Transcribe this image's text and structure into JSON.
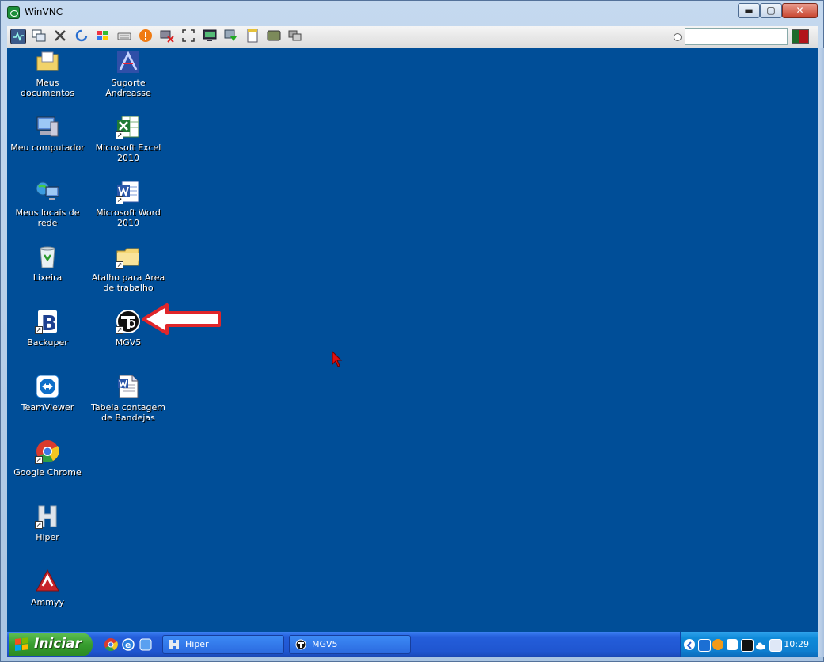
{
  "window": {
    "title": "WinVNC",
    "min_glyph": "▬",
    "max_glyph": "▢",
    "close_glyph": "✕"
  },
  "toolbar": {
    "buttons": [
      "options-icon",
      "copy-window-icon",
      "tools-icon",
      "refresh-icon",
      "windows-logo-icon",
      "keyboard-icon",
      "alert-icon",
      "disconnect-icon",
      "fullscreen-icon",
      "monitor-icon",
      "transfer-icon",
      "document-icon",
      "screen-icon",
      "chat-icon"
    ],
    "input_value": ""
  },
  "desktop": {
    "col1": [
      {
        "label": "Meus documentos",
        "icon": "folder-documents-icon"
      },
      {
        "label": "Meu computador",
        "icon": "computer-icon"
      },
      {
        "label": "Meus locais de rede",
        "icon": "network-icon"
      },
      {
        "label": "Lixeira",
        "icon": "recycle-bin-icon"
      },
      {
        "label": "Backuper",
        "icon": "backuper-icon"
      },
      {
        "label": "TeamViewer",
        "icon": "teamviewer-icon"
      },
      {
        "label": "Google Chrome",
        "icon": "chrome-icon"
      },
      {
        "label": "Hiper",
        "icon": "hiper-icon"
      },
      {
        "label": "Ammyy",
        "icon": "ammyy-icon"
      }
    ],
    "col2": [
      {
        "label": "Suporte Andreasse",
        "icon": "support-icon"
      },
      {
        "label": "Microsoft Excel 2010",
        "icon": "excel-icon"
      },
      {
        "label": "Microsoft Word 2010",
        "icon": "word-icon"
      },
      {
        "label": "Atalho para Area de trabalho",
        "icon": "folder-icon"
      },
      {
        "label": "MGV5",
        "icon": "mgv5-icon"
      },
      {
        "label": "Tabela contagem de Bandejas",
        "icon": "word-document-icon"
      }
    ]
  },
  "taskbar": {
    "start_label": "Iniciar",
    "buttons": [
      {
        "label": "Hiper"
      },
      {
        "label": "MGV5"
      }
    ],
    "clock": "10:29"
  },
  "colors": {
    "desktop": "#004e98",
    "taskbar": "#245edb",
    "start": "#379d2f",
    "arrow": "#e0262a"
  }
}
